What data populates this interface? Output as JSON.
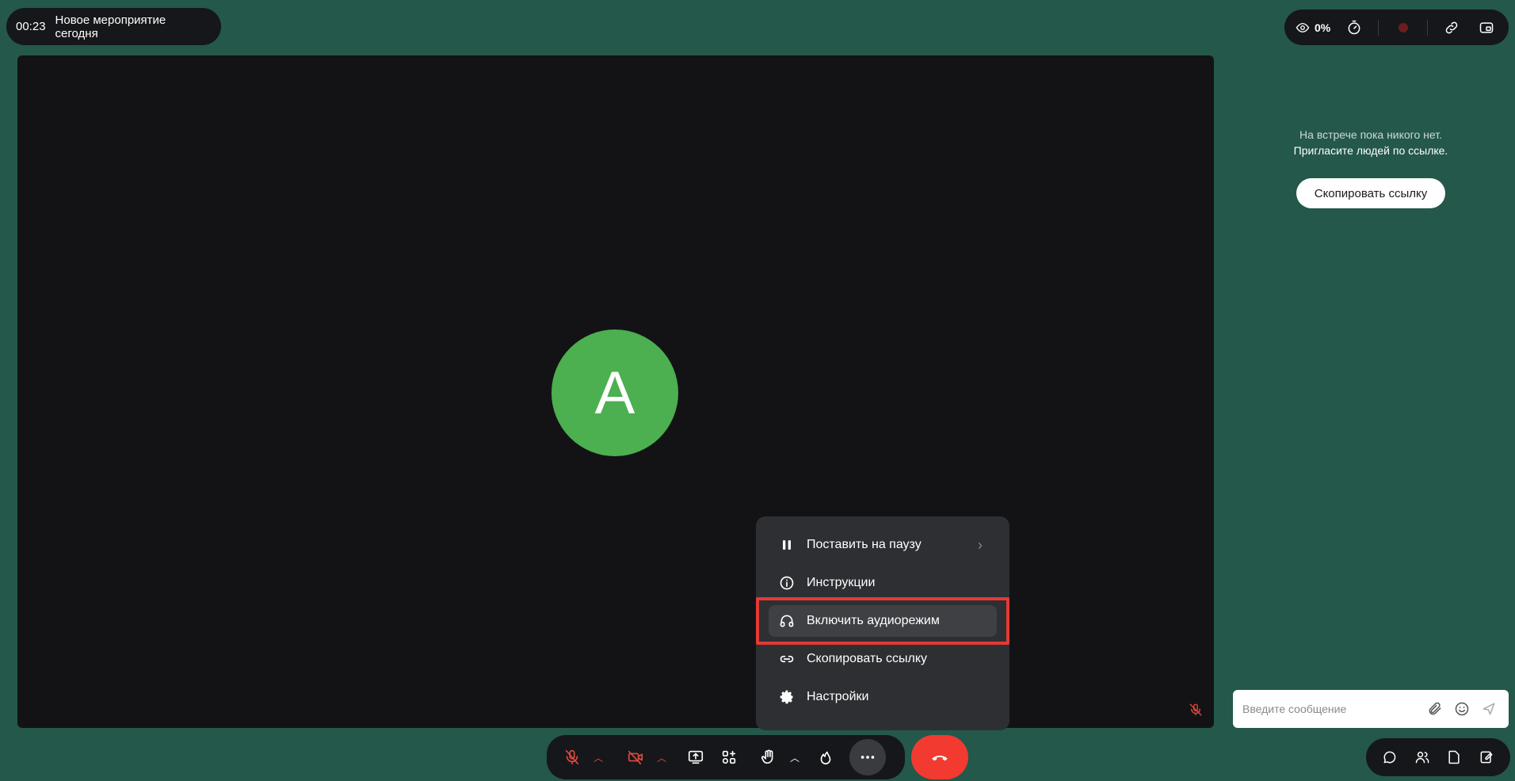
{
  "meeting": {
    "timer": "00:23",
    "title": "Новое мероприятие сегодня"
  },
  "top_bar": {
    "viewers_percent": "0%",
    "icons": [
      "eye-icon",
      "stopwatch-icon",
      "record-dot-icon",
      "link-icon",
      "picture-in-picture-icon"
    ]
  },
  "stage": {
    "avatar_letter": "A",
    "avatar_color": "#4caf50"
  },
  "menu": {
    "items": [
      {
        "label": "Поставить на паузу",
        "icon": "pause-icon",
        "has_submenu": true
      },
      {
        "label": "Инструкции",
        "icon": "info-icon"
      },
      {
        "label": "Включить аудиорежим",
        "icon": "headphones-icon",
        "highlighted": true
      },
      {
        "label": "Скопировать ссылку",
        "icon": "link-icon"
      },
      {
        "label": "Настройки",
        "icon": "gear-icon"
      }
    ]
  },
  "right_panel": {
    "empty_line1": "На встрече пока никого нет.",
    "empty_line2": "Пригласите людей по ссылке.",
    "copy_link_label": "Скопировать ссылку",
    "chat_placeholder": "Введите сообщение"
  },
  "colors": {
    "background": "#23584b",
    "hangup": "#f33a30",
    "highlight_border": "#e53935",
    "muted_red": "#e24a3f"
  }
}
